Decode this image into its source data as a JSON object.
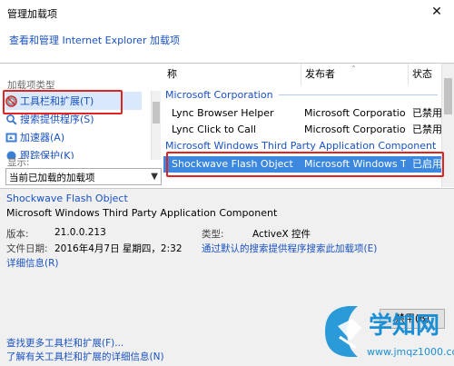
{
  "window": {
    "title": "管理加载项",
    "close_glyph": "✕"
  },
  "header": {
    "link": "查看和管理 Internet Explorer 加载项"
  },
  "left": {
    "types_label": "加载项类型",
    "items": [
      {
        "label": "工具栏和扩展(T)",
        "icon": "gear-block-icon"
      },
      {
        "label": "搜索提供程序(S)",
        "icon": "search-icon"
      },
      {
        "label": "加速器(A)",
        "icon": "accelerator-icon"
      },
      {
        "label": "跟踪保护(K)",
        "icon": "tracking-icon"
      }
    ],
    "show_label": "显示:",
    "show_value": "当前已加载的加载项"
  },
  "grid": {
    "columns": [
      "称",
      "发布者",
      "状态"
    ],
    "groups": [
      {
        "name": "Microsoft Corporation",
        "rows": [
          {
            "name": "Lync Browser Helper",
            "publisher": "Microsoft Corporation",
            "status": "已禁用"
          },
          {
            "name": "Lync Click to Call",
            "publisher": "Microsoft Corporation",
            "status": "已禁用"
          }
        ]
      },
      {
        "name": "Microsoft Windows Third Party Application Component",
        "rows": [
          {
            "name": "Shockwave Flash Object",
            "publisher": "Microsoft Windows T...",
            "status": "已启用"
          }
        ]
      }
    ]
  },
  "details": {
    "name": "Shockwave Flash Object",
    "publisher": "Microsoft Windows Third Party Application Component",
    "version_label": "版本:",
    "version": "21.0.0.213",
    "date_label": "文件日期:",
    "date": "2016年4月7日 星期四，2:32",
    "more_info": "详细信息(R)",
    "type_label": "类型:",
    "type": "ActiveX 控件",
    "search_link": "通过默认的搜索提供程序搜索此加载项(E)",
    "disable_button": "禁用(B)",
    "find_more": "查找更多工具栏和扩展(F)...",
    "learn_more": "了解有关工具栏和扩展的详细信息(N)"
  },
  "watermark": {
    "brand": "学知网",
    "url": "www.jmqz1000.com"
  }
}
